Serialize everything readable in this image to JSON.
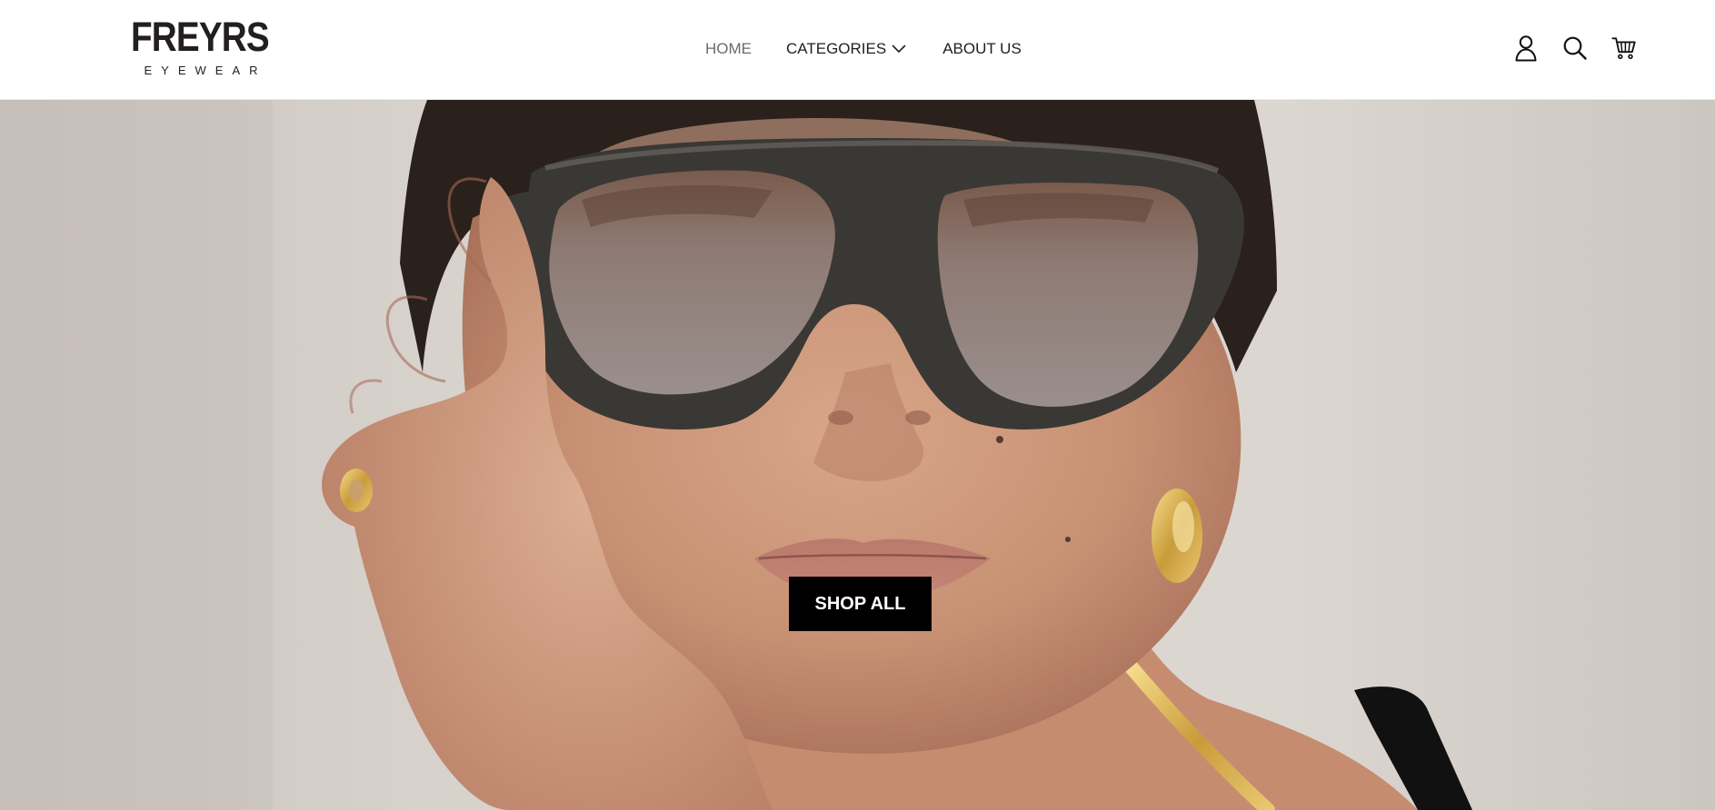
{
  "brand": {
    "name": "FREYRS",
    "tagline": "EYEWEAR"
  },
  "nav": {
    "items": [
      {
        "label": "HOME",
        "active": true
      },
      {
        "label": "CATEGORIES",
        "has_dropdown": true
      },
      {
        "label": "ABOUT US"
      }
    ]
  },
  "header_icons": [
    "account-icon",
    "search-icon",
    "cart-icon"
  ],
  "hero": {
    "cta_label": "SHOP ALL",
    "image_subject": "woman wearing dark aviator sunglasses"
  },
  "colors": {
    "text": "#1f1f1f",
    "nav_active": "#6b6b6b",
    "button_bg": "#000000",
    "button_text": "#ffffff"
  }
}
